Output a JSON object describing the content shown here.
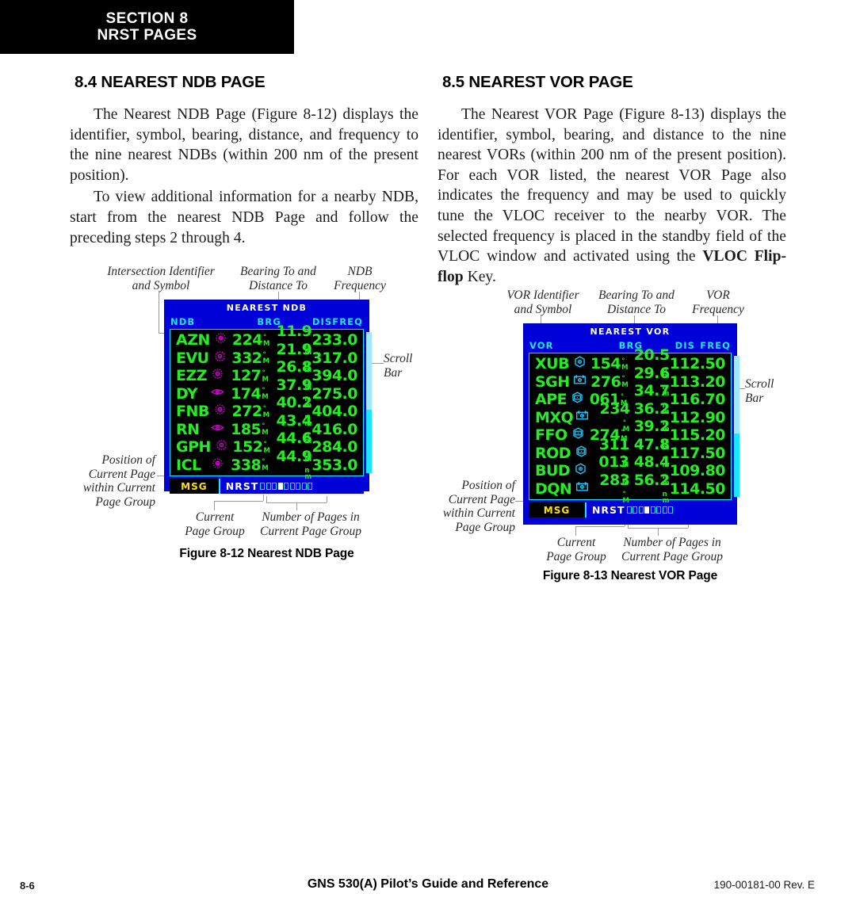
{
  "header": {
    "line1": "SECTION 8",
    "line2": "NRST PAGES"
  },
  "left_column": {
    "heading": "8.4  NEAREST NDB PAGE",
    "paragraph1": "The Nearest NDB Page (Figure 8-12) displays the identifier, symbol, bearing, distance, and frequency to the nine nearest NDBs (within 200 nm of the present position).",
    "paragraph2": "To view additional information for a nearby NDB, start from the nearest NDB Page and follow the preceding steps 2 through 4."
  },
  "right_column": {
    "heading": "8.5  NEAREST VOR PAGE",
    "paragraph1_a": "The Nearest VOR Page (Figure 8-13) displays the identifier, symbol, bearing, and distance to the nine nearest VORs (within 200 nm of the present position). For each VOR listed, the nearest VOR Page also indicates the frequency and may be used to quickly tune the VLOC receiver to the nearby VOR.  The selected frequency is placed in the standby field of the VLOC window and activated using the ",
    "paragraph1_bold": "VLOC  Flip-flop",
    "paragraph1_b": " Key."
  },
  "ndb_figure": {
    "caption": "Figure 8-12  Nearest NDB Page",
    "annotations": {
      "identifier": "Intersection Identifier\nand Symbol",
      "bearing": "Bearing To and\nDistance To",
      "frequency": "NDB\nFrequency",
      "scrollbar": "Scroll\nBar",
      "position": "Position of\nCurrent Page\nwithin Current\nPage Group",
      "current_group": "Current\nPage Group",
      "num_pages": "Number of Pages in\nCurrent Page Group"
    },
    "screen": {
      "title": "NEAREST NDB",
      "columns": [
        "NDB",
        "BRG",
        "DIS",
        "FREQ"
      ],
      "rows": [
        {
          "id": "AZN",
          "symbol": "ndb-station-icon",
          "brg": "224",
          "brg_unit": "°M",
          "dis": "11.9",
          "dis_unit": "nm",
          "freq": "233.0"
        },
        {
          "id": "EVU",
          "symbol": "ndb-station-icon",
          "brg": "332",
          "brg_unit": "°M",
          "dis": "21.9",
          "dis_unit": "nm",
          "freq": "317.0"
        },
        {
          "id": "EZZ",
          "symbol": "ndb-station-icon",
          "brg": "127",
          "brg_unit": "°M",
          "dis": "26.8",
          "dis_unit": "nm",
          "freq": "394.0"
        },
        {
          "id": "DY",
          "symbol": "ndb-locator-icon",
          "brg": "174",
          "brg_unit": "°M",
          "dis": "37.9",
          "dis_unit": "nm",
          "freq": "275.0"
        },
        {
          "id": "FNB",
          "symbol": "ndb-station-icon",
          "brg": "272",
          "brg_unit": "°M",
          "dis": "40.2",
          "dis_unit": "nm",
          "freq": "404.0"
        },
        {
          "id": "RN",
          "symbol": "ndb-locator-icon",
          "brg": "185",
          "brg_unit": "°M",
          "dis": "43.4",
          "dis_unit": "nm",
          "freq": "416.0"
        },
        {
          "id": "GPH",
          "symbol": "ndb-station-icon",
          "brg": "152",
          "brg_unit": "°M",
          "dis": "44.6",
          "dis_unit": "nm",
          "freq": "284.0"
        },
        {
          "id": "ICL",
          "symbol": "ndb-station-icon",
          "brg": "338",
          "brg_unit": "°M",
          "dis": "44.9",
          "dis_unit": "nm",
          "freq": "353.0"
        }
      ],
      "status_bar": {
        "message_label": "MSG",
        "page_group_label": "NRST",
        "page_dots_total": 9,
        "page_dots_active_index": 3
      },
      "colors": {
        "background": "#0000d8",
        "list_background": "#000000",
        "data_text": "#22ee22",
        "header_text": "#19e6ff",
        "symbol": "#e000e0",
        "message": "#ffe000"
      }
    }
  },
  "vor_figure": {
    "caption": "Figure 8-13  Nearest VOR Page",
    "annotations": {
      "identifier": "VOR Identifier\nand Symbol",
      "bearing": "Bearing To and\nDistance To",
      "frequency": "VOR\nFrequency",
      "scrollbar": "Scroll\nBar",
      "position": "Position of\nCurrent Page\nwithin Current\nPage Group",
      "current_group": "Current\nPage Group",
      "num_pages": "Number of Pages in\nCurrent Page Group"
    },
    "screen": {
      "title": "NEAREST VOR",
      "columns": [
        "VOR",
        "BRG",
        "DIS",
        "FREQ"
      ],
      "rows": [
        {
          "id": "XUB",
          "symbol": "vor-icon",
          "brg": "154",
          "brg_unit": "°M",
          "dis": "20.5",
          "dis_unit": "nm",
          "freq": "112.50"
        },
        {
          "id": "SGH",
          "symbol": "vortac-icon",
          "brg": "276",
          "brg_unit": "°M",
          "dis": "29.6",
          "dis_unit": "nm",
          "freq": "113.20"
        },
        {
          "id": "APE",
          "symbol": "vordme-icon",
          "brg": "061",
          "brg_unit": "°M",
          "dis": "34.7",
          "dis_unit": "nm",
          "freq": "116.70"
        },
        {
          "id": "MXQ",
          "symbol": "vortac-icon",
          "brg": "234",
          "brg_unit": "°M",
          "dis": "36.2",
          "dis_unit": "nm",
          "freq": "112.90"
        },
        {
          "id": "FFO",
          "symbol": "vordme-icon",
          "brg": "274",
          "brg_unit": "°M",
          "dis": "39.2",
          "dis_unit": "nm",
          "freq": "115.20"
        },
        {
          "id": "ROD",
          "symbol": "vordme-icon",
          "brg": "311",
          "brg_unit": "°M",
          "dis": "47.8",
          "dis_unit": "nm",
          "freq": "117.50"
        },
        {
          "id": "BUD",
          "symbol": "vor-icon",
          "brg": "013",
          "brg_unit": "°M",
          "dis": "48.4",
          "dis_unit": "nm",
          "freq": "109.80"
        },
        {
          "id": "DQN",
          "symbol": "vortac-icon",
          "brg": "283",
          "brg_unit": "°M",
          "dis": "56.2",
          "dis_unit": "nm",
          "freq": "114.50"
        }
      ],
      "status_bar": {
        "message_label": "MSG",
        "page_group_label": "NRST",
        "page_dots_total": 8,
        "page_dots_active_index": 3
      },
      "colors": {
        "background": "#0000d8",
        "list_background": "#000000",
        "data_text": "#22ee22",
        "header_text": "#19e6ff",
        "symbol": "#19c8ff",
        "message": "#ffe000"
      }
    }
  },
  "footer": {
    "page_number": "8-6",
    "title": "GNS 530(A) Pilot’s Guide and Reference",
    "document_id": "190-00181-00  Rev. E"
  }
}
